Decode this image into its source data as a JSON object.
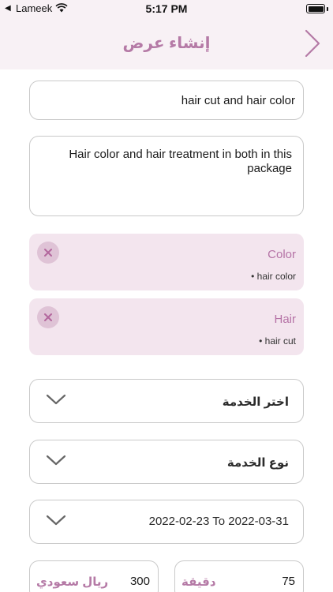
{
  "status": {
    "carrier": "Lameek",
    "time": "5:17 PM"
  },
  "header": {
    "title": "إنشاء عرض"
  },
  "form": {
    "offer_title": "hair cut and hair color",
    "offer_description": "Hair color and hair treatment in both in this package"
  },
  "selected_services": [
    {
      "name": "Color",
      "item": "• hair color"
    },
    {
      "name": "Hair",
      "item": "• hair cut"
    }
  ],
  "dropdowns": {
    "choose_service": "اختر الخدمة",
    "service_type": "نوع الخدمة",
    "date_range": "2022-02-23 To 2022-03-31"
  },
  "price": {
    "value": "300",
    "unit": "ريال سعودي"
  },
  "duration": {
    "value": "75",
    "unit": "دقيقة"
  },
  "colors": {
    "accent": "#b57aa6",
    "header_bg": "#f8f1f5",
    "card_bg": "#f3e5ee"
  }
}
